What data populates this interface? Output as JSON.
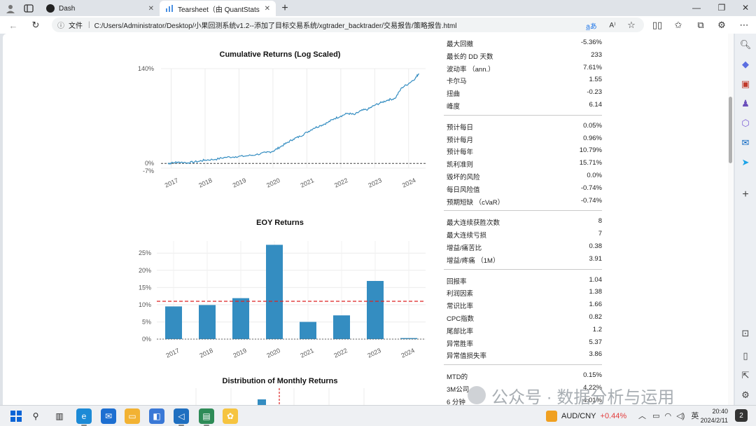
{
  "browser": {
    "tabs": [
      {
        "title": "Dash",
        "active": false
      },
      {
        "title": "Tearsheet（由 QuantStats 生成）",
        "active": true
      }
    ],
    "new_tab_label": "+",
    "address": {
      "scheme_label": "文件",
      "url": "C:/Users/Administrator/Desktop/小果回测系统v1.2--添加了目标交易系统/xgtrader_backtrader/交易报告/策略报告.html"
    }
  },
  "charts": {
    "cumulative": {
      "title": "Cumulative Returns (Log Scaled)",
      "y_ticks": [
        "140%",
        "0%",
        "-7%"
      ],
      "x_ticks": [
        "2017",
        "2018",
        "2019",
        "2020",
        "2021",
        "2022",
        "2023",
        "2024"
      ]
    },
    "eoy": {
      "title": "EOY Returns",
      "y_ticks": [
        "25%",
        "20%",
        "15%",
        "10%",
        "5%",
        "0%"
      ],
      "x_ticks": [
        "2017",
        "2018",
        "2019",
        "2020",
        "2021",
        "2022",
        "2023",
        "2024"
      ]
    },
    "distribution": {
      "title": "Distribution of Monthly Returns"
    }
  },
  "chart_data": [
    {
      "type": "line",
      "title": "Cumulative Returns (Log Scaled)",
      "x": [
        2016.9,
        2017.0,
        2017.2,
        2017.5,
        2017.8,
        2018.0,
        2018.3,
        2018.6,
        2018.9,
        2019.2,
        2019.5,
        2019.8,
        2020.0,
        2020.2,
        2020.4,
        2020.6,
        2020.8,
        2021.0,
        2021.2,
        2021.4,
        2021.6,
        2021.8,
        2022.0,
        2022.2,
        2022.4,
        2022.6,
        2022.8,
        2023.0,
        2023.2,
        2023.4,
        2023.6,
        2023.8,
        2024.0,
        2024.2,
        2024.3
      ],
      "y": [
        0,
        0.5,
        2,
        1,
        3,
        5,
        6,
        9,
        10,
        11,
        13,
        16,
        18,
        24,
        30,
        36,
        40,
        46,
        52,
        56,
        60,
        66,
        70,
        74,
        72,
        78,
        80,
        86,
        90,
        94,
        96,
        112,
        118,
        126,
        133
      ],
      "series": [
        {
          "name": "",
          "color": "#348dc1"
        }
      ],
      "xlim": [
        2016.7,
        2024.5
      ],
      "ylim": [
        -7,
        140
      ],
      "y_ticks": [
        140,
        0,
        -7
      ],
      "baseline": 0,
      "grid": true
    },
    {
      "type": "bar",
      "title": "EOY Returns",
      "categories": [
        "2017",
        "2018",
        "2019",
        "2020",
        "2021",
        "2022",
        "2023",
        "2024"
      ],
      "values": [
        9.5,
        9.9,
        11.9,
        27.4,
        5.0,
        6.9,
        16.9,
        0.3
      ],
      "ylim": [
        0,
        28.5
      ],
      "y_ticks": [
        0,
        5,
        10,
        15,
        20,
        25
      ],
      "mean_line": 11.0,
      "bar_color": "#348dc1",
      "mean_color": "#dd2222",
      "grid": true
    }
  ],
  "metrics": {
    "groups": [
      [
        {
          "label": "最大回撤",
          "value": "-5.36%"
        },
        {
          "label": "最长的 DD 天数",
          "value": "233"
        },
        {
          "label": "波动率 （ann.）",
          "value": "7.61%"
        },
        {
          "label": "卡尔马",
          "value": "1.55"
        },
        {
          "label": "扭曲",
          "value": "-0.23"
        },
        {
          "label": "峰度",
          "value": "6.14"
        }
      ],
      [
        {
          "label": "预计每日",
          "value": "0.05%"
        },
        {
          "label": "预计每月",
          "value": "0.96%"
        },
        {
          "label": "预计每年",
          "value": "10.79%"
        },
        {
          "label": "凯利准则",
          "value": "15.71%"
        },
        {
          "label": "毁坏的风险",
          "value": "0.0%"
        },
        {
          "label": "每日风险值",
          "value": "-0.74%"
        },
        {
          "label": "预期短缺 （cVaR）",
          "value": "-0.74%"
        }
      ],
      [
        {
          "label": "最大连续获胜次数",
          "value": "8"
        },
        {
          "label": "最大连续亏损",
          "value": "7"
        },
        {
          "label": "增益/痛苦比",
          "value": "0.38"
        },
        {
          "label": "增益/疼痛 （1M）",
          "value": "3.91"
        }
      ],
      [
        {
          "label": "回报率",
          "value": "1.04"
        },
        {
          "label": "利润因素",
          "value": "1.38"
        },
        {
          "label": "常识比率",
          "value": "1.66"
        },
        {
          "label": "CPC指数",
          "value": "0.82"
        },
        {
          "label": "尾部比率",
          "value": "1.2"
        },
        {
          "label": "异常胜率",
          "value": "5.37"
        },
        {
          "label": "异常值损失率",
          "value": "3.86"
        }
      ],
      [
        {
          "label": "MTD的",
          "value": "0.15%"
        },
        {
          "label": "3M公司",
          "value": "4.22%"
        },
        {
          "label": "6 分钟",
          "value": "4.01%"
        }
      ]
    ]
  },
  "watermark": {
    "text": "公众号 · 数据分析与运用"
  },
  "taskbar": {
    "ticker_symbol": "AUD/CNY",
    "ticker_change": "+0.44%",
    "ime": "英",
    "time": "20:40",
    "date": "2024/2/11",
    "notifications": "2"
  },
  "colors": {
    "accent": "#348dc1",
    "mean_line": "#dd2222",
    "ticker_up": "#e23b3b"
  }
}
